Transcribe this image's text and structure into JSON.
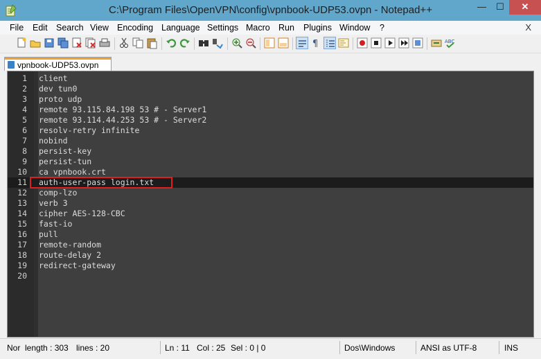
{
  "window": {
    "title": "C:\\Program Files\\OpenVPN\\config\\vpnbook-UDP53.ovpn - Notepad++",
    "minimize_glyph": "—",
    "maximize_glyph": "☐",
    "close_glyph": "✕"
  },
  "menu": {
    "items": [
      "File",
      "Edit",
      "Search",
      "View",
      "Encoding",
      "Language",
      "Settings",
      "Macro",
      "Run",
      "Plugins",
      "Window",
      "?"
    ],
    "close_glyph": "X"
  },
  "toolbar": {
    "icons": [
      "new-file-icon",
      "open-file-icon",
      "save-icon",
      "save-all-icon",
      "close-file-icon",
      "close-all-icon",
      "print-icon",
      "cut-icon",
      "copy-icon",
      "paste-icon",
      "undo-icon",
      "redo-icon",
      "find-icon",
      "replace-icon",
      "zoom-in-icon",
      "zoom-out-icon",
      "sync-vertical-icon",
      "sync-horizontal-icon",
      "word-wrap-icon",
      "show-all-characters-icon",
      "indent-guide-icon",
      "document-map-icon",
      "record-macro-icon",
      "stop-macro-icon",
      "play-macro-icon",
      "play-multiple-macro-icon",
      "save-macro-icon",
      "launch-icon",
      "spell-check-icon"
    ]
  },
  "tabs": [
    {
      "label": "vpnbook-UDP53.ovpn"
    }
  ],
  "editor": {
    "current_line": 11,
    "lines": [
      "client",
      "dev tun0",
      "proto udp",
      "remote 93.115.84.198 53 # - Server1",
      "remote 93.114.44.253 53 # - Server2",
      "resolv-retry infinite",
      "nobind",
      "persist-key",
      "persist-tun",
      "ca vpnbook.crt",
      "auth-user-pass login.txt",
      "comp-lzo",
      "verb 3",
      "cipher AES-128-CBC",
      "fast-io",
      "pull",
      "remote-random",
      "route-delay 2",
      "redirect-gateway",
      ""
    ],
    "line_numbers": [
      "1",
      "2",
      "3",
      "4",
      "5",
      "6",
      "7",
      "8",
      "9",
      "10",
      "11",
      "12",
      "13",
      "14",
      "15",
      "16",
      "17",
      "18",
      "19",
      "20"
    ]
  },
  "status": {
    "doc_type": "Nor",
    "length": "length : 303",
    "lines": "lines : 20",
    "ln": "Ln : 11",
    "col": "Col : 25",
    "sel": "Sel : 0 | 0",
    "eol": "Dos\\Windows",
    "encoding": "ANSI as UTF-8",
    "mode": "INS"
  },
  "colors": {
    "editor_bg": "#3f3f3f",
    "gutter_bg": "#2b2b2b",
    "current_line_bg": "#1c1c1c",
    "highlight_border": "#e01e1e",
    "title_bar": "#61a7cc"
  }
}
